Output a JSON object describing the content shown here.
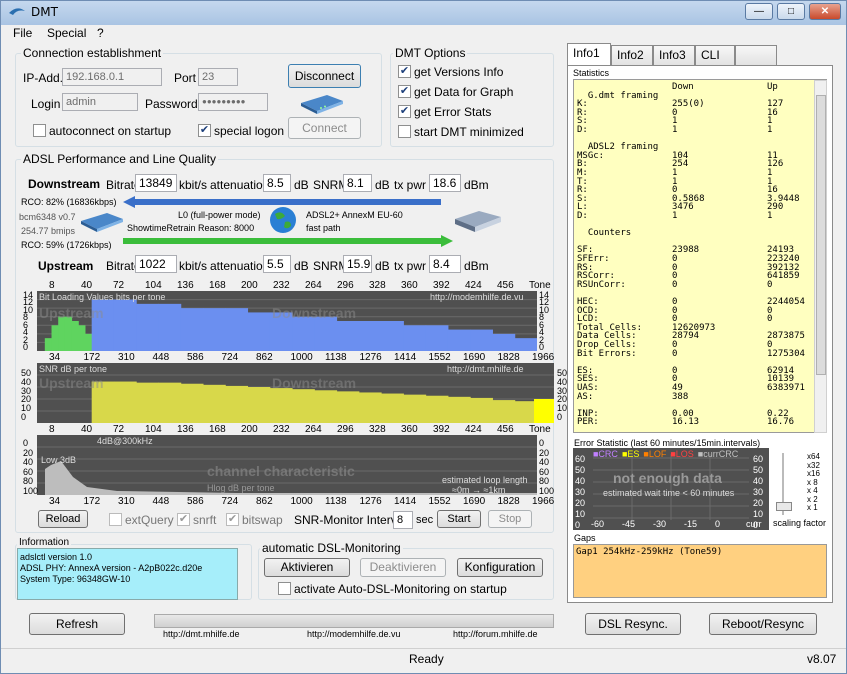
{
  "window": {
    "title": "DMT",
    "btn_min": "—",
    "btn_max": "□",
    "btn_close": "✕"
  },
  "menu": [
    "File",
    "Special",
    "?"
  ],
  "conn": {
    "group": "Connection establishment",
    "ip_label": "IP-Add.",
    "ip_value": "192.168.0.1",
    "port_label": "Port",
    "port_value": "23",
    "login_label": "Login",
    "login_value": "admin",
    "password_label": "Password",
    "password_value": "●●●●●●●●●",
    "disconnect": "Disconnect",
    "connect": "Connect",
    "autoconnect": "autoconnect on startup",
    "special_logon": "special logon"
  },
  "dmt_options": {
    "group": "DMT Options",
    "items": [
      "get Versions Info",
      "get Data for Graph",
      "get Error Stats",
      "start DMT minimized"
    ],
    "checked": [
      true,
      true,
      true,
      false
    ]
  },
  "adsl": {
    "group": "ADSL Performance and Line Quality",
    "downstream": {
      "label": "Downstream",
      "bitrate_label": "Bitrate",
      "bitrate": "13849",
      "unit1": "kbit/s",
      "att_label": "attenuation",
      "att": "8.5",
      "db1": "dB",
      "snrm_label": "SNRM",
      "snrm": "8.1",
      "db2": "dB",
      "txpwr_label": "tx pwr",
      "txpwr": "18.6",
      "dbm": "dBm"
    },
    "upstream": {
      "label": "Upstream",
      "bitrate_label": "Bitrate",
      "bitrate": "1022",
      "unit1": "kbit/s",
      "att_label": "attenuation",
      "att": "5.5",
      "db1": "dB",
      "snrm_label": "SNRM",
      "snrm": "15.9",
      "db2": "dB",
      "txpwr_label": "tx pwr",
      "txpwr": "8.4",
      "dbm": "dBm"
    },
    "rco_down": "RCO: 82% (16836kbps)",
    "bcm": "bcm6348 v0.7",
    "bmips": "254.77 bmips",
    "rco_up": "RCO: 59% (1726kbps)",
    "mode": "L0 (full-power mode)",
    "retrain": "ShowtimeRetrain Reason: 8000",
    "standard": "ADSL2+ AnnexM EU-60",
    "path": "fast path"
  },
  "chart_top_ticks": [
    "8",
    "40",
    "72",
    "104",
    "136",
    "168",
    "200",
    "232",
    "264",
    "296",
    "328",
    "360",
    "392",
    "424",
    "456",
    "Tone"
  ],
  "chart_bottom_ticks": [
    "34",
    "172",
    "310",
    "448",
    "586",
    "724",
    "862",
    "1000",
    "1138",
    "1276",
    "1414",
    "1552",
    "1690",
    "1828",
    "1966",
    "kHz"
  ],
  "chart_data": [
    {
      "type": "bar",
      "title": "Bit Loading Values   bits per tone",
      "watermark_left": "Upstream",
      "watermark_right": "Downstream",
      "url": "http://modemhilfe.de.vu",
      "y_ticks": [
        "14",
        "12",
        "10",
        "8",
        "6",
        "4",
        "2",
        "0"
      ],
      "ylim": [
        0,
        14
      ],
      "x_label": "Tone",
      "series": [
        {
          "name": "Upstream",
          "range": [
            8,
            56
          ],
          "values": [
            3,
            6,
            8,
            8,
            7,
            6,
            4
          ]
        },
        {
          "name": "Downstream",
          "range": [
            56,
            512
          ],
          "values": [
            12,
            12,
            11,
            11,
            10,
            10,
            10,
            9,
            9,
            8,
            8,
            7,
            7,
            7,
            6,
            6,
            5,
            5,
            4,
            3
          ]
        }
      ]
    },
    {
      "type": "bar",
      "title": "SNR  dB per tone",
      "watermark_left": "Upstream",
      "watermark_right": "Downstream",
      "url": "http://dmt.mhilfe.de",
      "y_ticks": [
        "50",
        "40",
        "30",
        "20",
        "10",
        "0"
      ],
      "ylim": [
        0,
        55
      ],
      "x_label": "Tone",
      "series": [
        {
          "name": "SNR",
          "range": [
            56,
            512
          ],
          "values": [
            38,
            38,
            37,
            37,
            36,
            35,
            34,
            33,
            32,
            31,
            30,
            29,
            28,
            27,
            26,
            25,
            24,
            23,
            21,
            20
          ]
        }
      ]
    },
    {
      "type": "bar",
      "title": "4dB@300kHz",
      "watermark": "channel characteristic",
      "sub": "Hlog  dB per tone",
      "note1": "estimated loop length",
      "note2": "≈0m  →  ≈1km",
      "low_label": "Low 3dB",
      "y_ticks": [
        "0",
        "20",
        "40",
        "60",
        "80",
        "100"
      ],
      "ylim": [
        0,
        100
      ],
      "x_label": "kHz"
    }
  ],
  "bottom_ctrl": {
    "reload": "Reload",
    "extquery": "extQuery",
    "snrft": "snrft",
    "bitswap": "bitswap",
    "snr_interval_label": "SNR-Monitor Interval:",
    "snr_interval": "8",
    "sec": "sec",
    "start": "Start",
    "stop": "Stop"
  },
  "info": {
    "group": "Information",
    "lines": [
      "adslctl version 1.0",
      "ADSL PHY: AnnexA version - A2pB022c.d20e",
      "System Type: 96348GW-10"
    ]
  },
  "auto_dsl": {
    "group": "automatic DSL-Monitoring",
    "activate": "Aktivieren",
    "deactivate": "Deaktivieren",
    "config": "Konfiguration",
    "startup": "activate Auto-DSL-Monitoring on startup"
  },
  "footer": {
    "refresh": "Refresh",
    "link1": "http://dmt.mhilfe.de",
    "link2": "http://modemhilfe.de.vu",
    "link3": "http://forum.mhilfe.de",
    "resync": "DSL Resync.",
    "reboot": "Reboot/Resync",
    "status": "Ready",
    "version": "v8.07"
  },
  "tabs": [
    "Info1",
    "Info2",
    "Info3",
    "CLI"
  ],
  "stats": {
    "heading": "Statistics",
    "rows": [
      [
        " ",
        "Down",
        "Up"
      ],
      [
        "  G.dmt framing",
        "",
        ""
      ],
      [
        "K:",
        "255(0)",
        "127"
      ],
      [
        "R:",
        "0",
        "16"
      ],
      [
        "S:",
        "1",
        "1"
      ],
      [
        "D:",
        "1",
        "1"
      ],
      [
        " ",
        "",
        ""
      ],
      [
        "  ADSL2 framing",
        "",
        ""
      ],
      [
        "MSGc:",
        "104",
        "11"
      ],
      [
        "B:",
        "254",
        "126"
      ],
      [
        "M:",
        "1",
        "1"
      ],
      [
        "T:",
        "1",
        "1"
      ],
      [
        "R:",
        "0",
        "16"
      ],
      [
        "S:",
        "0.5868",
        "3.9448"
      ],
      [
        "L:",
        "3476",
        "290"
      ],
      [
        "D:",
        "1",
        "1"
      ],
      [
        " ",
        "",
        ""
      ],
      [
        "  Counters",
        "",
        ""
      ],
      [
        " ",
        "",
        ""
      ],
      [
        "SF:",
        "23988",
        "24193"
      ],
      [
        "SFErr:",
        "0",
        "223240"
      ],
      [
        "RS:",
        "0",
        "392132"
      ],
      [
        "RSCorr:",
        "0",
        "641859"
      ],
      [
        "RSUnCorr:",
        "0",
        "0"
      ],
      [
        " ",
        "",
        ""
      ],
      [
        "HEC:",
        "0",
        "2244054"
      ],
      [
        "OCD:",
        "0",
        "0"
      ],
      [
        "LCD:",
        "0",
        "0"
      ],
      [
        "Total Cells:",
        "12620973",
        ""
      ],
      [
        "Data Cells:",
        "28794",
        "2873875"
      ],
      [
        "Drop Cells:",
        "0",
        "0"
      ],
      [
        "Bit Errors:",
        "0",
        "1275304"
      ],
      [
        " ",
        "",
        ""
      ],
      [
        "ES:",
        "0",
        "62914"
      ],
      [
        "SES:",
        "0",
        "10139"
      ],
      [
        "UAS:",
        "49",
        "6383971"
      ],
      [
        "AS:",
        "388",
        ""
      ],
      [
        " ",
        "",
        ""
      ],
      [
        "INP:",
        "0.00",
        "0.22"
      ],
      [
        "PER:",
        "16.13",
        "16.76"
      ]
    ]
  },
  "err_stat": {
    "title": "Error Statistic (last 60 minutes/15min.intervals)",
    "legend": [
      "CRC",
      "ES",
      "LOF",
      "LOS",
      "currCRC"
    ],
    "legend_colors": [
      "#c080ff",
      "#ffff00",
      "#ff8000",
      "#ff4040",
      "#c0c0c0"
    ],
    "msg": "not enough data",
    "sub": "estimated wait time < 60 minutes",
    "y_ticks": [
      "60",
      "50",
      "40",
      "30",
      "20",
      "10",
      "0"
    ],
    "x_ticks": [
      "-60",
      "-45",
      "-30",
      "-15",
      "0",
      "curr"
    ],
    "scale_ticks": [
      "x64",
      "x32",
      "x16",
      "x 8",
      "x 4",
      "x 2",
      "x 1"
    ],
    "scale_label": "scaling factor"
  },
  "gaps": {
    "title": "Gaps",
    "text": "Gap1 254kHz-259kHz (Tone59)"
  }
}
